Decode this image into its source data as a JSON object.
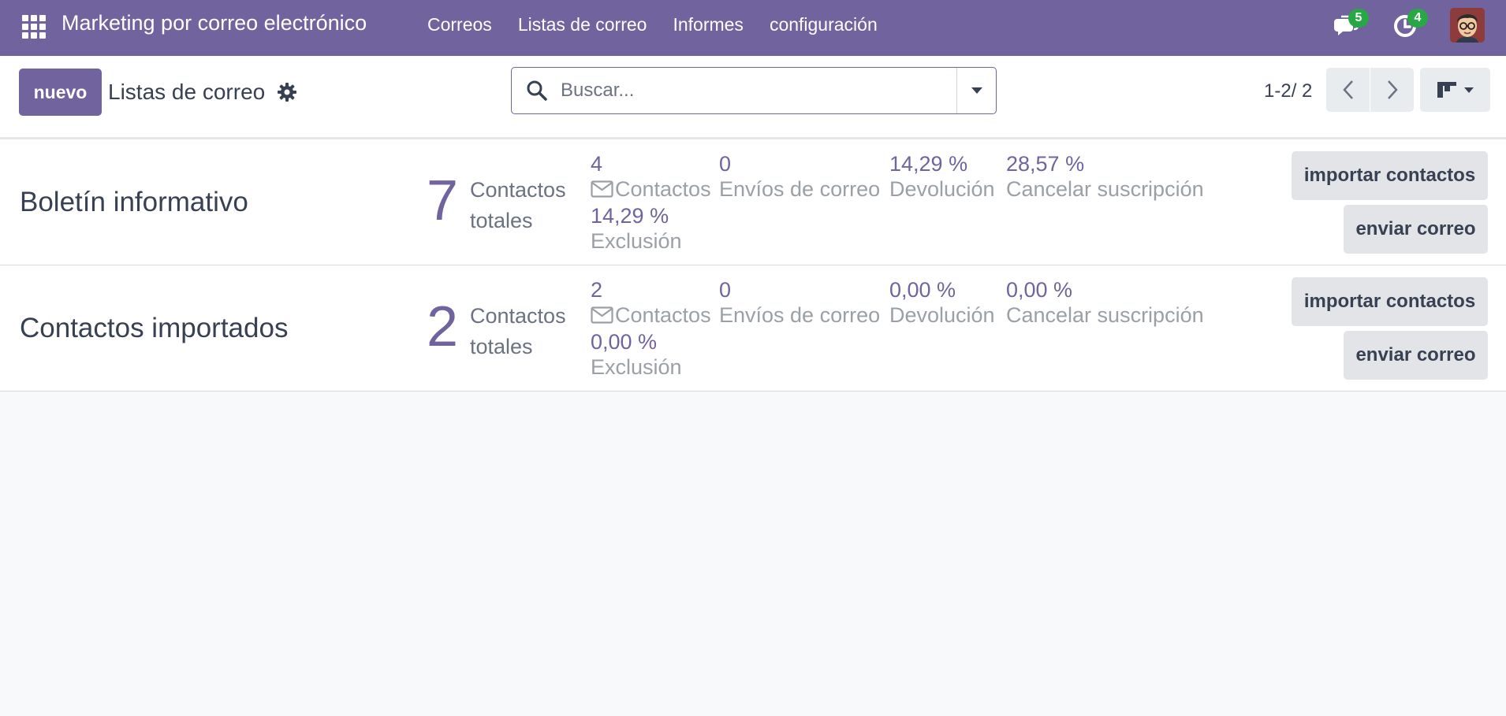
{
  "navbar": {
    "app_title": "Marketing por correo electrónico",
    "menu": [
      "Correos",
      "Listas de correo",
      "Informes",
      "configuración"
    ],
    "messages_count": "5",
    "activities_count": "4",
    "accent_color": "#71639e",
    "badge_color": "#28a745"
  },
  "control_panel": {
    "new_label": "nuevo",
    "breadcrumb": "Listas de correo",
    "search_placeholder": "Buscar...",
    "pager_value": "1-2/ 2"
  },
  "lists": [
    {
      "name": "Boletín informativo",
      "total_contacts": "7",
      "total_label": "Contactos totales",
      "contacts_value": "4",
      "contacts_label": "Contactos",
      "mailings_value": "0",
      "mailings_label": "Envíos de correo",
      "bounce_value": "14,29 %",
      "bounce_label": "Devolución",
      "unsubscribe_value": "28,57 %",
      "unsubscribe_label": "Cancelar suscripción",
      "exclusion_value": "14,29 %",
      "exclusion_label": "Exclusión",
      "import_label": "importar contactos",
      "send_label": "enviar correo"
    },
    {
      "name": "Contactos importados",
      "total_contacts": "2",
      "total_label": "Contactos totales",
      "contacts_value": "2",
      "contacts_label": "Contactos",
      "mailings_value": "0",
      "mailings_label": "Envíos de correo",
      "bounce_value": "0,00 %",
      "bounce_label": "Devolución",
      "unsubscribe_value": "0,00 %",
      "unsubscribe_label": "Cancelar suscripción",
      "exclusion_value": "0,00 %",
      "exclusion_label": "Exclusión",
      "import_label": "importar contactos",
      "send_label": "enviar correo"
    }
  ]
}
